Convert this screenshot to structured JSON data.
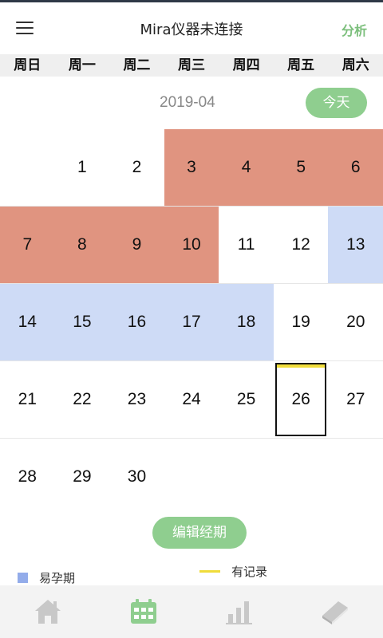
{
  "header": {
    "title": "Mira仪器未连接",
    "analysis_label": "分析"
  },
  "weekdays": [
    "周日",
    "周一",
    "周二",
    "周三",
    "周四",
    "周五",
    "周六"
  ],
  "calendar": {
    "month": "2019-04",
    "today_label": "今天",
    "rows": [
      [
        {
          "d": ""
        },
        {
          "d": "1"
        },
        {
          "d": "2"
        },
        {
          "d": "3",
          "t": "period"
        },
        {
          "d": "4",
          "t": "period"
        },
        {
          "d": "5",
          "t": "period"
        },
        {
          "d": "6",
          "t": "period"
        }
      ],
      [
        {
          "d": "7",
          "t": "period"
        },
        {
          "d": "8",
          "t": "period"
        },
        {
          "d": "9",
          "t": "period"
        },
        {
          "d": "10",
          "t": "period"
        },
        {
          "d": "11"
        },
        {
          "d": "12"
        },
        {
          "d": "13",
          "t": "fertile"
        }
      ],
      [
        {
          "d": "14",
          "t": "fertile"
        },
        {
          "d": "15",
          "t": "fertile"
        },
        {
          "d": "16",
          "t": "fertile"
        },
        {
          "d": "17",
          "t": "fertile"
        },
        {
          "d": "18",
          "t": "fertile"
        },
        {
          "d": "19"
        },
        {
          "d": "20"
        }
      ],
      [
        {
          "d": "21"
        },
        {
          "d": "22"
        },
        {
          "d": "23"
        },
        {
          "d": "24"
        },
        {
          "d": "25"
        },
        {
          "d": "26",
          "t": "today",
          "record": true
        },
        {
          "d": "27"
        }
      ],
      [
        {
          "d": "28"
        },
        {
          "d": "29"
        },
        {
          "d": "30"
        },
        {
          "d": ""
        },
        {
          "d": ""
        },
        {
          "d": ""
        },
        {
          "d": ""
        }
      ]
    ]
  },
  "edit_period_label": "编辑经期",
  "legend": {
    "fertile_label": "易孕期",
    "record_label": "有记录"
  },
  "tabs": [
    {
      "name": "home",
      "icon": "home-icon"
    },
    {
      "name": "calendar",
      "icon": "calendar-icon",
      "active": true
    },
    {
      "name": "stats",
      "icon": "bar-chart-icon"
    },
    {
      "name": "knowledge",
      "icon": "book-icon"
    }
  ],
  "colors": {
    "accent_green": "#8fce8f",
    "period": "#e09480",
    "fertile": "#cedbf6",
    "record_mark": "#f0dc3a",
    "tab_icon_inactive": "#c8c8c8"
  }
}
